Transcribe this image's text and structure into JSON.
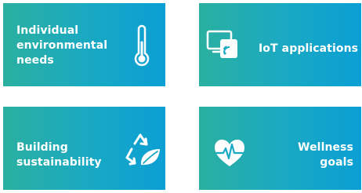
{
  "tiles": [
    {
      "label": "Individual\nenvironmental\nneeds",
      "icon": "thermometer-icon"
    },
    {
      "label": "IoT applications",
      "icon": "iot-device-icon"
    },
    {
      "label": "Building\nsustainability",
      "icon": "recycle-leaf-icon"
    },
    {
      "label": "Wellness\ngoals",
      "icon": "heart-pulse-icon"
    }
  ],
  "colors": {
    "gradient_start": "#2bb0a0",
    "gradient_mid": "#1aa9c3",
    "gradient_end": "#0b9fd4",
    "text": "#ffffff"
  }
}
